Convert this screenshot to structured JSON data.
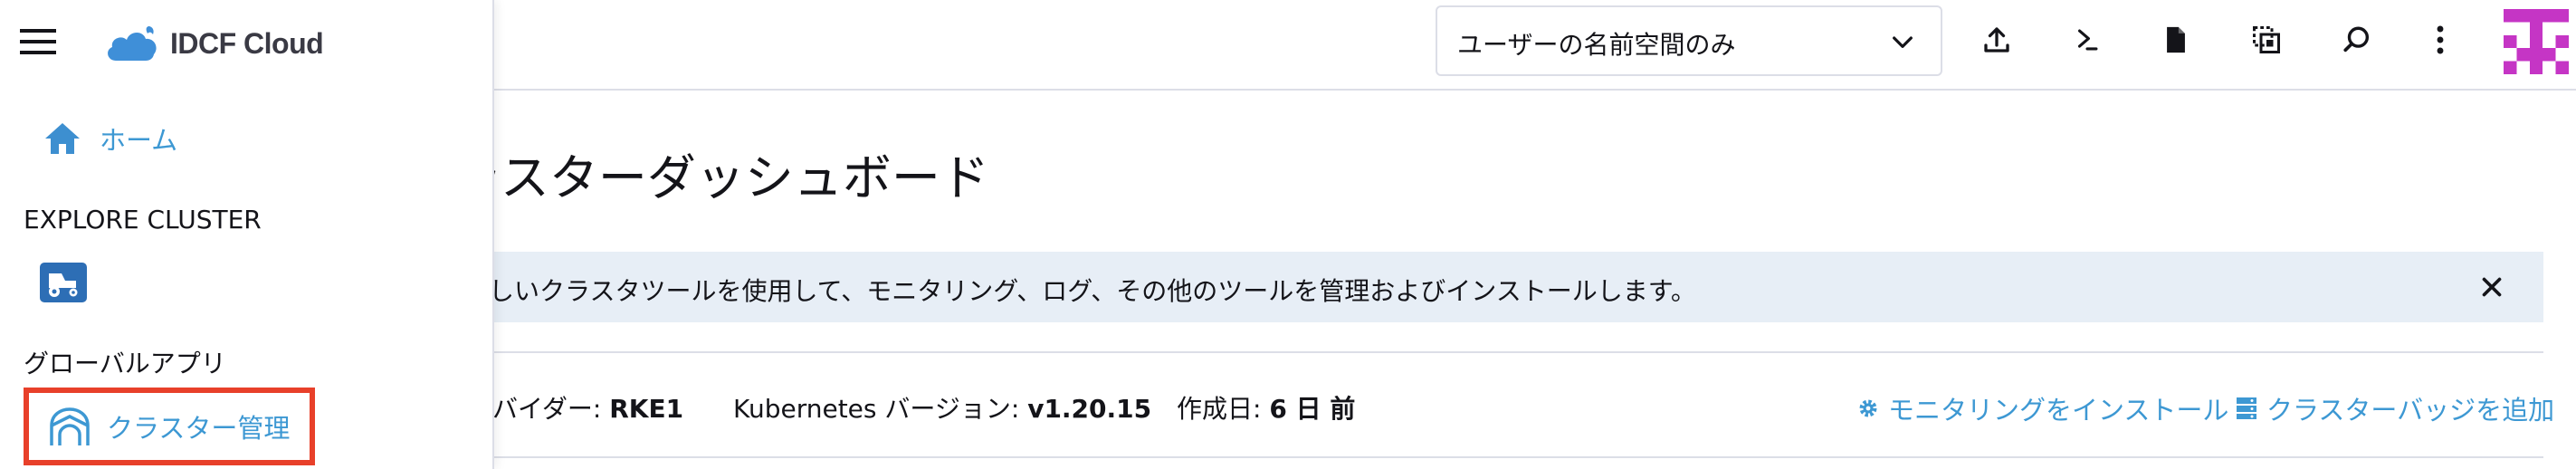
{
  "header": {
    "breadcrumb_fragment": "0",
    "namespace_filter": "ユーザーの名前空間のみ",
    "toolbar_icons": [
      "upload-icon",
      "terminal-icon",
      "file-icon",
      "copy-kubeconfig-icon",
      "search-icon",
      "more-vertical-icon"
    ]
  },
  "side_menu": {
    "brand": "IDCF Cloud",
    "home_label": "ホーム",
    "explore_cluster_header": "EXPLORE CLUSTER",
    "global_apps_header": "グローバルアプリ",
    "cluster_management_label": "クラスター管理"
  },
  "page": {
    "title": "ラスターダッシュボード",
    "banner_message": "しいクラスタツールを使用して、モニタリング、ログ、その他のツールを管理およびインストールします。",
    "meta": {
      "provider_label": "バイダー:",
      "provider_value": "RKE1",
      "k8s_label": "Kubernetes バージョン:",
      "k8s_value": "v1.20.15",
      "created_label": "作成日:",
      "created_value": "6 日 前"
    },
    "actions": {
      "install_monitoring": "モニタリングをインストール",
      "add_cluster_badge": "クラスターバッジを追加"
    }
  },
  "colors": {
    "link": "#3d98d3",
    "highlight_border": "#e8402a",
    "banner_bg": "#e7eef6",
    "avatar": "#c535c5"
  }
}
